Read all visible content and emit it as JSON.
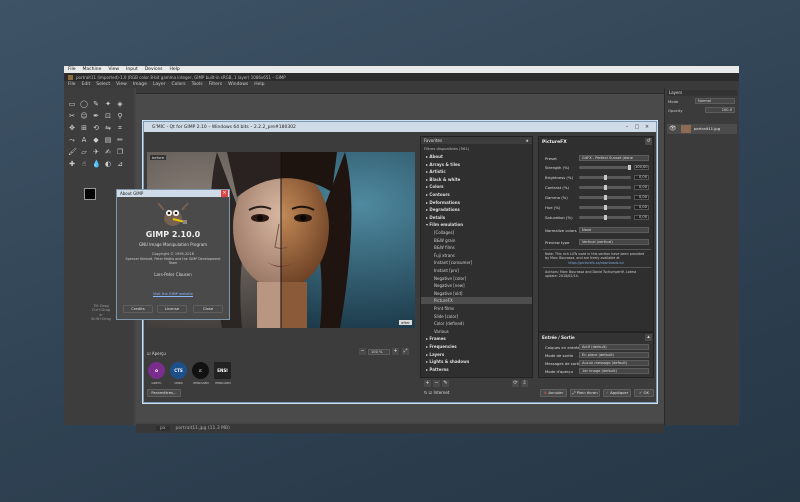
{
  "vm_menubar": [
    "File",
    "Machine",
    "View",
    "Input",
    "Devices",
    "Help"
  ],
  "gimp": {
    "title": "portrait11 (imported)-1.0 (RGB color 8-bit gamma integer, GIMP built-in sRGB, 1 layer) 1086x651 – GIMP",
    "menus": [
      "File",
      "Edit",
      "Select",
      "View",
      "Image",
      "Layer",
      "Colors",
      "Tools",
      "Filters",
      "Windows",
      "Help"
    ],
    "status_text": "portrait11.jpg (11.3 MB)",
    "zoom_unit": "px",
    "dock": {
      "tab": "Layers",
      "mode_label": "Mode",
      "mode_value": "Normal",
      "opacity_label": "Opacity",
      "opacity_value": "100.0",
      "layer_name": "portrait11.jpg"
    },
    "toolbox_hint": "Tilt Drag Ctrl+Drag or Shift+Drag"
  },
  "gmic": {
    "title": "G'MIC - Qt for GIMP 2.10 – Windows 64 bits – 2.2.2_pre#180302",
    "preview_label": "before",
    "preview_after": "after",
    "preview_checkbox": "Aperçu",
    "zoom_value": "100 %",
    "settings_button": "Paramètres...",
    "favorites_header": "Favorites",
    "filters_count_label": "Filtres disponibles (561)",
    "filter_items": [
      {
        "label": "About",
        "cls": "cat"
      },
      {
        "label": "Arrays & tiles",
        "cls": "cat"
      },
      {
        "label": "Artistic",
        "cls": "cat"
      },
      {
        "label": "Black & white",
        "cls": "cat"
      },
      {
        "label": "Colors",
        "cls": "cat"
      },
      {
        "label": "Contours",
        "cls": "cat"
      },
      {
        "label": "Deformations",
        "cls": "cat"
      },
      {
        "label": "Degradations",
        "cls": "cat"
      },
      {
        "label": "Details",
        "cls": "cat"
      },
      {
        "label": "Film emulation",
        "cls": "cat"
      },
      {
        "label": "[Collages]",
        "cls": "sub"
      },
      {
        "label": "B&W grain",
        "cls": "sub"
      },
      {
        "label": "B&W films",
        "cls": "sub"
      },
      {
        "label": "Fuji xtrans",
        "cls": "sub"
      },
      {
        "label": "Instant [consumer]",
        "cls": "sub"
      },
      {
        "label": "Instant [pro]",
        "cls": "sub"
      },
      {
        "label": "Negative [color]",
        "cls": "sub"
      },
      {
        "label": "Negative [new]",
        "cls": "sub"
      },
      {
        "label": "Negative [old]",
        "cls": "sub"
      },
      {
        "label": "PictureFX",
        "cls": "sub sel"
      },
      {
        "label": "Print films",
        "cls": "sub"
      },
      {
        "label": "Slide [color]",
        "cls": "sub"
      },
      {
        "label": "Color (defined)",
        "cls": "sub"
      },
      {
        "label": "Various",
        "cls": "sub"
      },
      {
        "label": "Frames",
        "cls": "cat"
      },
      {
        "label": "Frequencies",
        "cls": "cat"
      },
      {
        "label": "Layers",
        "cls": "cat"
      },
      {
        "label": "Lights & shadows",
        "cls": "cat"
      },
      {
        "label": "Patterns",
        "cls": "cat"
      }
    ],
    "internet_label": "Internet",
    "filter_title": "PictureFX",
    "preset_label": "Preset",
    "preset_value": "GitFX - Perfect Sunset (done",
    "params": [
      {
        "label": "Strength (%)",
        "value": "100,00",
        "pos": 1.0
      },
      {
        "label": "Brightness (%)",
        "value": "0,00",
        "pos": 0.5
      },
      {
        "label": "Contrast (%)",
        "value": "0,00",
        "pos": 0.5
      },
      {
        "label": "Gamma (%)",
        "value": "0,00",
        "pos": 0.5
      },
      {
        "label": "Hue (%)",
        "value": "0,00",
        "pos": 0.5
      },
      {
        "label": "Saturation (%)",
        "value": "0,00",
        "pos": 0.5
      }
    ],
    "normalize_label": "Normalize colors",
    "normalize_value": "None",
    "preview_type_label": "Preview type",
    "preview_type_value": "Vertical (vertical)",
    "note_text": "Note: This rich LUTs used in this section have been provided by Marc Bourassa, and are freely available at",
    "note_link": "https://picturefx.ca/downloads-lut",
    "author_text": "Authors: Marc Bourassa and David Tschumperlé. Latest update: 2018/02/14.",
    "io_header": "Entrée / Sortie",
    "io_rows": [
      {
        "label": "Calques en entrée",
        "value": "Actif (default)"
      },
      {
        "label": "Mode de sortie",
        "value": "En place (default)"
      },
      {
        "label": "Messages de sortie",
        "value": "Aucun message (default)"
      },
      {
        "label": "Mode d'aperçu",
        "value": "1er image (default)"
      }
    ],
    "buttons": {
      "cancel": "Annuler",
      "full": "Plein écran",
      "apply": "Appliquer",
      "ok": "OK"
    },
    "logos": [
      {
        "text": "GREYC",
        "color": "#7b2d8e"
      },
      {
        "text": "CNRS",
        "color": "#1d4f8a"
      },
      {
        "text": "ENSICAEN",
        "color": "#111111"
      },
      {
        "text": "ENSICAEN",
        "color": "#222222"
      }
    ]
  },
  "about": {
    "title": "About GIMP",
    "product": "GIMP 2.10.0",
    "subtitle": "GNU Image Manipulation Program",
    "copyright": "Copyright © 1995-2018",
    "authors": "Spencer Kimball, Peter Mattis and the GIMP Development Team",
    "tagline": "Lars-Peter Clausen",
    "link": "Visit the GIMP website",
    "btn_credits": "Credits",
    "btn_license": "License",
    "btn_close": "Close"
  }
}
